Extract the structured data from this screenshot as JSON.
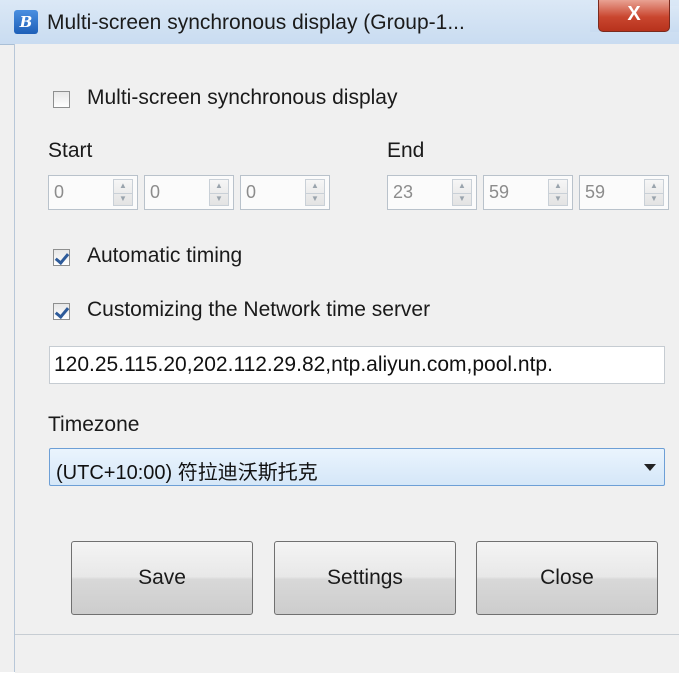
{
  "window": {
    "title": "Multi-screen synchronous display (Group-1...",
    "close_glyph": "X"
  },
  "sync_checkbox": {
    "label": "Multi-screen synchronous display",
    "checked": false
  },
  "start": {
    "label": "Start",
    "hour": "0",
    "minute": "0",
    "second": "0"
  },
  "end": {
    "label": "End",
    "hour": "23",
    "minute": "59",
    "second": "59"
  },
  "auto_timing": {
    "label": "Automatic timing",
    "checked": true
  },
  "custom_ntp": {
    "label": "Customizing the Network time server",
    "checked": true
  },
  "ntp_servers": {
    "value": "120.25.115.20,202.112.29.82,ntp.aliyun.com,pool.ntp."
  },
  "timezone": {
    "label": "Timezone",
    "selected": "(UTC+10:00) 符拉迪沃斯托克"
  },
  "buttons": {
    "save": "Save",
    "settings": "Settings",
    "close": "Close"
  },
  "icons": {
    "app": "app-logo-icon",
    "close": "close-icon",
    "spin_up": "chevron-up-icon",
    "spin_down": "chevron-down-icon",
    "dropdown": "dropdown-caret-icon"
  },
  "colors": {
    "titlebar": "#c9dcf1",
    "close_button": "#c9462f",
    "checkmark": "#2e5b9a",
    "select_border": "#6d9fd6"
  }
}
